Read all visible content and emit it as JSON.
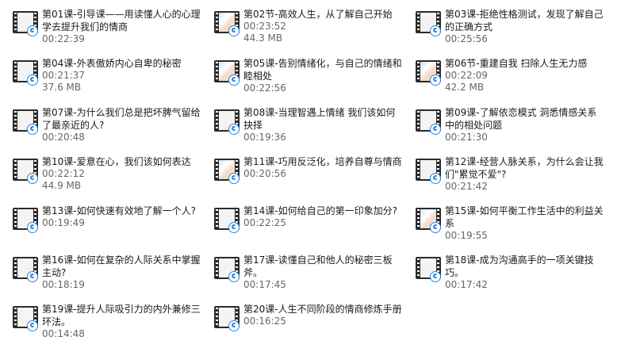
{
  "items": [
    {
      "title": "第01课-引导课——用读懂人心的心理学去提升我们的情商",
      "duration": "00:22:39",
      "size": ""
    },
    {
      "title": "第02节-高效人生，从了解自己开始",
      "duration": "00:23:52",
      "size": "44.3 MB"
    },
    {
      "title": "第03课-拒绝性格测试，发现了解自己的正确方式",
      "duration": "00:25:56",
      "size": ""
    },
    {
      "title": "第04课-外表傲娇内心自卑的秘密",
      "duration": "00:21:37",
      "size": "37.6 MB"
    },
    {
      "title": "第05课-告别情绪化，与自己的情绪和睦相处",
      "duration": "00:22:56",
      "size": ""
    },
    {
      "title": "第06节-重建自我 扫除人生无力感",
      "duration": "00:22:09",
      "size": "42.2 MB"
    },
    {
      "title": "第07课-为什么我们总是把坏脾气留给了最亲近的人?",
      "duration": "00:20:48",
      "size": ""
    },
    {
      "title": "第08课-当理智遇上情绪 我们该如何抉择",
      "duration": "00:19:36",
      "size": ""
    },
    {
      "title": "第09课-了解依恋模式 洞悉情感关系中的相处问题",
      "duration": "00:21:30",
      "size": ""
    },
    {
      "title": "第10课-爱意在心，我们该如何表达",
      "duration": "00:22:12",
      "size": "44.9 MB"
    },
    {
      "title": "第11课-巧用反泛化，培养自尊与情商",
      "duration": "00:20:56",
      "size": ""
    },
    {
      "title": "第12课-经营人脉关系，为什么会让我们\"累觉不爱\"?",
      "duration": "00:21:42",
      "size": ""
    },
    {
      "title": "第13课-如何快速有效地了解一个人?",
      "duration": "00:19:49",
      "size": ""
    },
    {
      "title": "第14课-如何给自己的第一印象加分?",
      "duration": "00:22:25",
      "size": ""
    },
    {
      "title": "第15课-如何平衡工作生活中的利益关系",
      "duration": "00:19:55",
      "size": ""
    },
    {
      "title": "第16课-如何在复杂的人际关系中掌握主动?",
      "duration": "00:18:19",
      "size": ""
    },
    {
      "title": "第17课-读懂自己和他人的秘密三板斧。",
      "duration": "00:17:45",
      "size": ""
    },
    {
      "title": "第18课-成为沟通高手的一项关键技巧。",
      "duration": "00:17:42",
      "size": ""
    },
    {
      "title": "第19课-提升人际吸引力的内外兼修三环法。",
      "duration": "00:14:48",
      "size": ""
    },
    {
      "title": "第20课-人生不同阶段的情商修炼手册",
      "duration": "00:16:25",
      "size": ""
    }
  ]
}
